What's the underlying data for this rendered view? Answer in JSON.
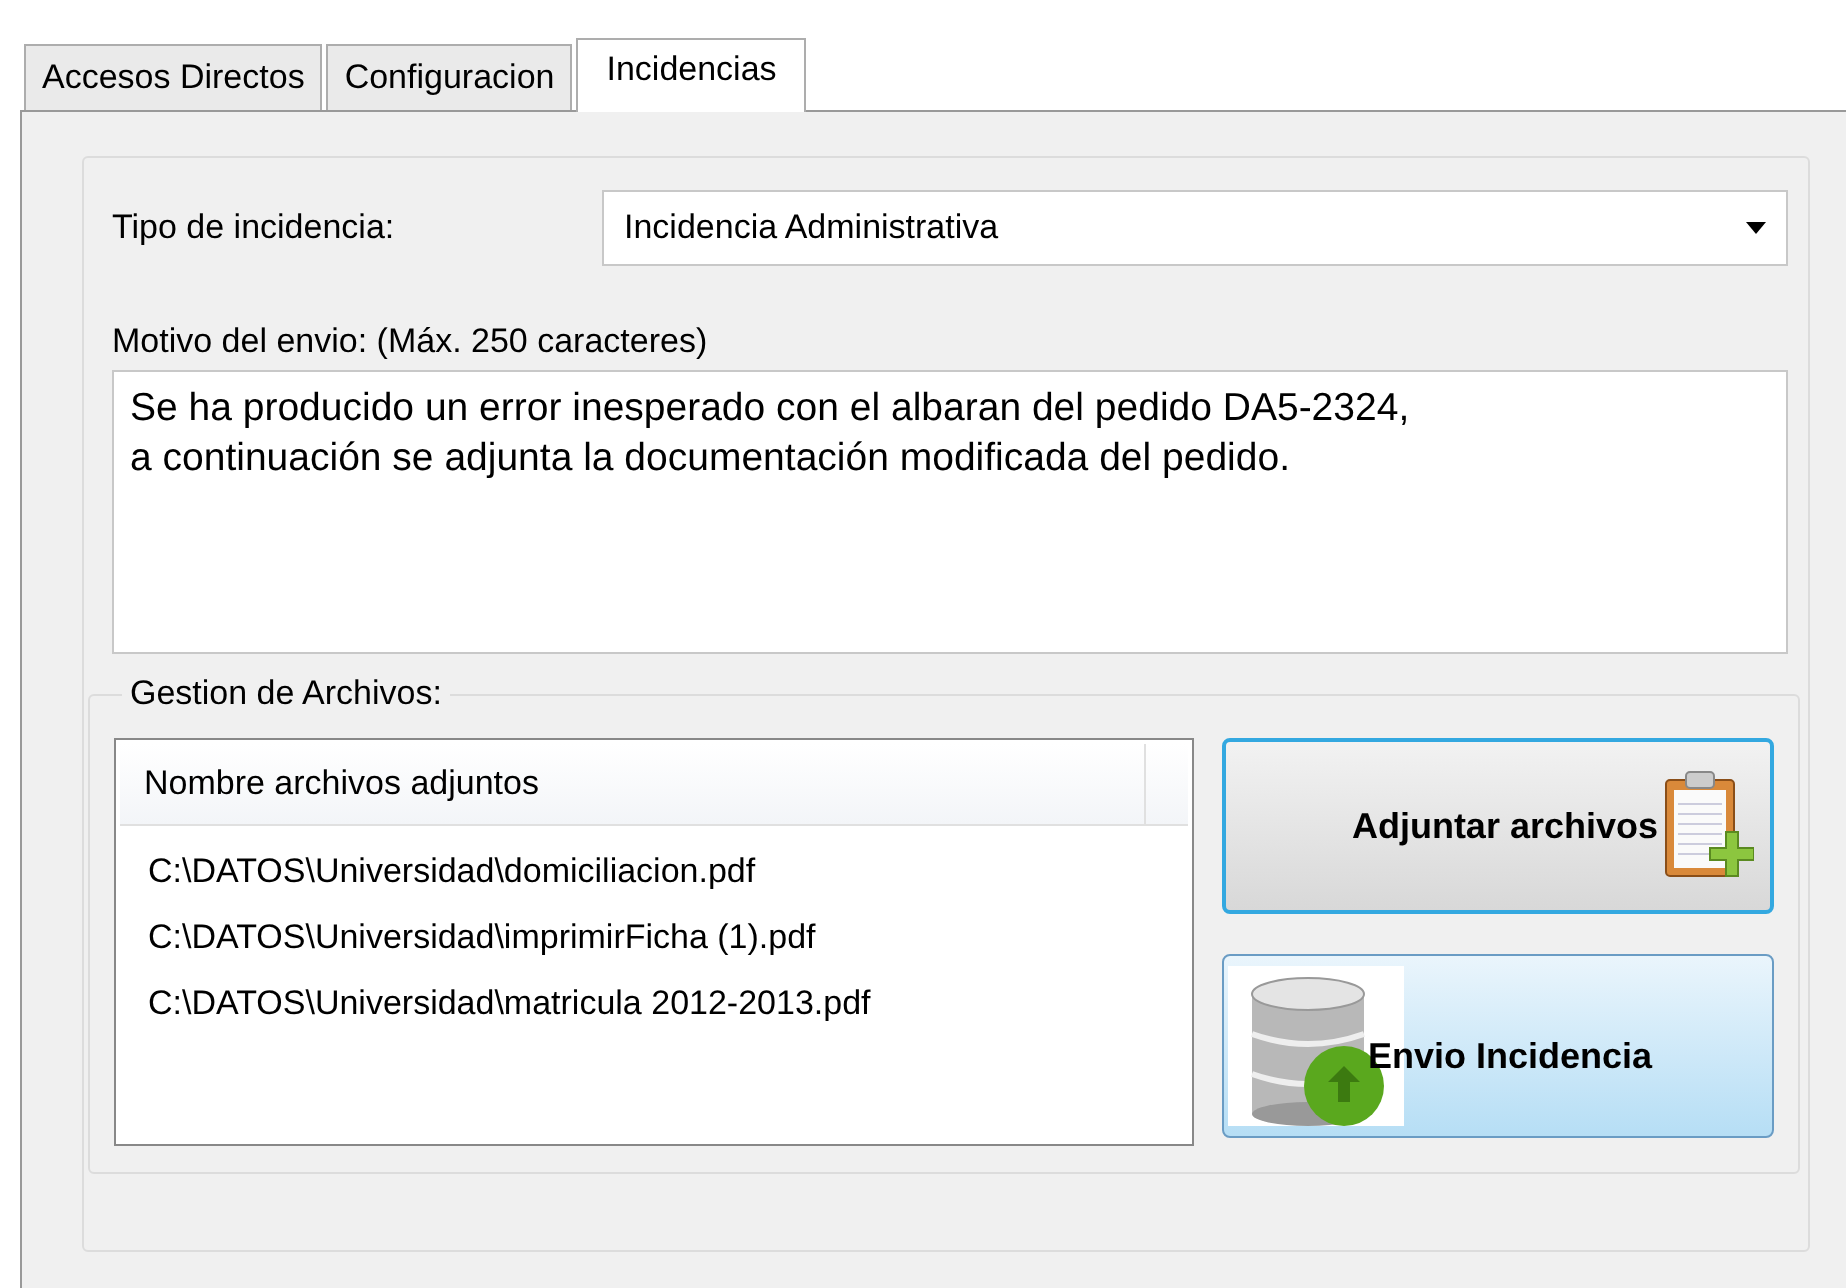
{
  "tabs": [
    {
      "label": "Accesos Directos",
      "selected": false
    },
    {
      "label": "Configuracion",
      "selected": false
    },
    {
      "label": "Incidencias",
      "selected": true
    }
  ],
  "incident_type": {
    "label": "Tipo de incidencia:",
    "value": "Incidencia Administrativa"
  },
  "reason": {
    "label": "Motivo del envio: (Máx. 250 caracteres)",
    "value": "Se ha producido un error inesperado con el albaran del pedido DA5-2324,\na continuación se adjunta la documentación modificada del pedido."
  },
  "file_management": {
    "title": "Gestion de Archivos:",
    "list": {
      "columns": [
        "Nombre archivos adjuntos"
      ],
      "rows": [
        "C:\\DATOS\\Universidad\\domiciliacion.pdf",
        "C:\\DATOS\\Universidad\\imprimirFicha (1).pdf",
        "C:\\DATOS\\Universidad\\matricula 2012-2013.pdf"
      ]
    },
    "buttons": [
      {
        "kind": "attach",
        "label": "Adjuntar archivos"
      },
      {
        "kind": "send",
        "label": "Envio Incidencia"
      }
    ]
  }
}
